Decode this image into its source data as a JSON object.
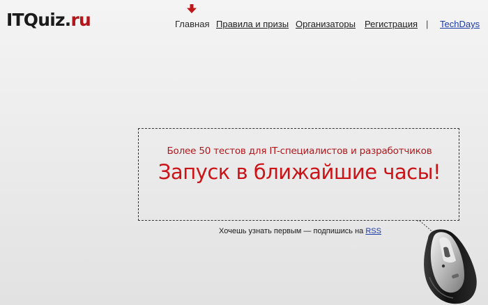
{
  "logo": {
    "part_main": "ITQuiz",
    "part_dot": ".",
    "part_tld": "ru"
  },
  "nav": {
    "items": [
      {
        "label": "Главная",
        "current": true
      },
      {
        "label": "Правила и призы"
      },
      {
        "label": "Организаторы"
      },
      {
        "label": "Регистрация"
      }
    ],
    "separator": "|",
    "extra_link": "TechDays"
  },
  "announcement": {
    "subtitle": "Более 50 тестов для IT-специалистов и разработчиков",
    "headline": "Запуск в ближайшие часы!"
  },
  "subscribe": {
    "text": "Хочешь узнать первым — подпишись на",
    "link": "RSS"
  },
  "colors": {
    "accent_red": "#cc1418",
    "link_blue": "#1a3aa8"
  },
  "icons": {
    "nav_marker": "arrow-down-icon",
    "mascot": "computer-mouse-icon"
  }
}
